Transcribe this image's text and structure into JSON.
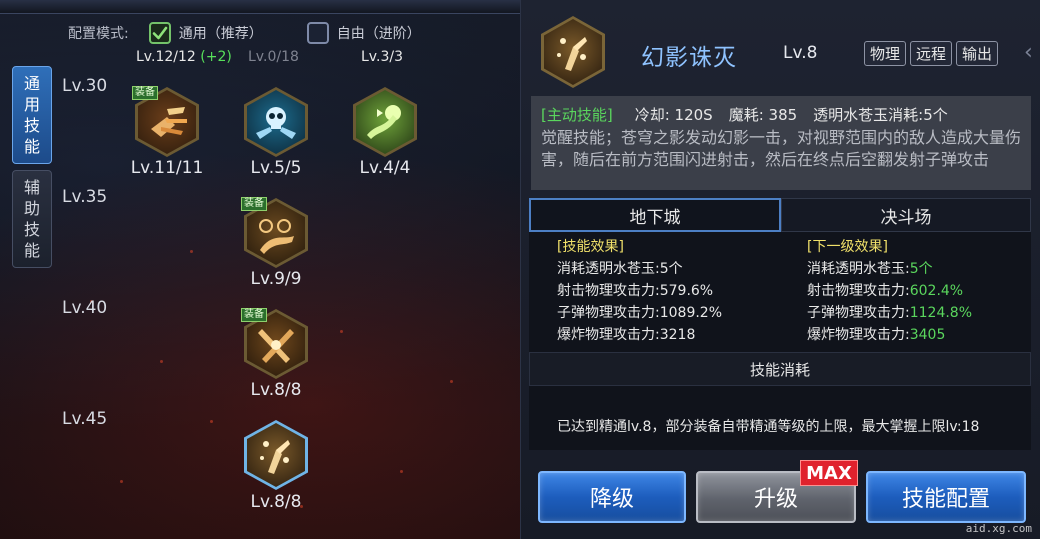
{
  "mode": {
    "label": "配置模式:",
    "options": [
      {
        "label": "通用（推荐）",
        "checked": true
      },
      {
        "label": "自由（进阶）",
        "checked": false
      }
    ]
  },
  "counts": {
    "first": "Lv.12/12",
    "first_plus": "(+2)",
    "second": "Lv.0/18",
    "third": "Lv.3/3"
  },
  "side_tabs": [
    {
      "label": "通用技能",
      "active": true
    },
    {
      "label": "辅助技能",
      "active": false
    }
  ],
  "level_rows": [
    "Lv.30",
    "Lv.35",
    "Lv.40",
    "Lv.45"
  ],
  "skills": [
    {
      "level": "Lv.11/11",
      "equip": "装备",
      "icon": "rapid-fire-icon"
    },
    {
      "level": "Lv.5/5",
      "equip": "",
      "icon": "skull-guns-icon"
    },
    {
      "level": "Lv.4/4",
      "equip": "",
      "icon": "green-blast-icon"
    },
    {
      "level": "Lv.9/9",
      "equip": "装备",
      "icon": "crosshair-slash-icon"
    },
    {
      "level": "Lv.8/8",
      "equip": "装备",
      "icon": "cross-blade-icon"
    },
    {
      "level": "Lv.8/8",
      "equip": "",
      "icon": "phantom-strike-icon"
    }
  ],
  "detail": {
    "name": "幻影诛灭",
    "level": "Lv.8",
    "tags": [
      "物理",
      "远程",
      "输出"
    ],
    "active_tag": "[主动技能]",
    "cooldown": "冷却: 120S",
    "mp_cost": "魔耗: 385",
    "jade_cost": "透明水苍玉消耗:5个",
    "description": "觉醒技能；苍穹之影发动幻影一击，对视野范围内的敌人造成大量伤害，随后在前方范围闪进射击，然后在终点后空翻发射子弹攻击"
  },
  "tabs": [
    {
      "label": "地下城",
      "active": true
    },
    {
      "label": "决斗场",
      "active": false
    }
  ],
  "effects": {
    "current": {
      "header": "[技能效果]",
      "lines": [
        {
          "label": "消耗透明水苍玉:",
          "value": "5个"
        },
        {
          "label": "射击物理攻击力:",
          "value": "579.6%"
        },
        {
          "label": "子弹物理攻击力:",
          "value": "1089.2%"
        },
        {
          "label": "爆炸物理攻击力:",
          "value": "3218"
        }
      ]
    },
    "next": {
      "header": "[下一级效果]",
      "lines": [
        {
          "label": "消耗透明水苍玉:",
          "value": "5个"
        },
        {
          "label": "射击物理攻击力:",
          "value": "602.4%"
        },
        {
          "label": "子弹物理攻击力:",
          "value": "1124.8%"
        },
        {
          "label": "爆炸物理攻击力:",
          "value": "3405"
        }
      ]
    }
  },
  "cost_title": "技能消耗",
  "mastery_text": "已达到精通lv.8，部分装备自带精通等级的上限，最大掌握上限lv:18",
  "buttons": {
    "downgrade": "降级",
    "upgrade": "升级",
    "config": "技能配置",
    "max_badge": "MAX"
  },
  "watermark": "aid.xg.com",
  "colors": {
    "accent_blue": "#2f6fb9",
    "green": "#5ad65d",
    "yellow": "#f0e06a",
    "max_red": "#e0222d"
  }
}
